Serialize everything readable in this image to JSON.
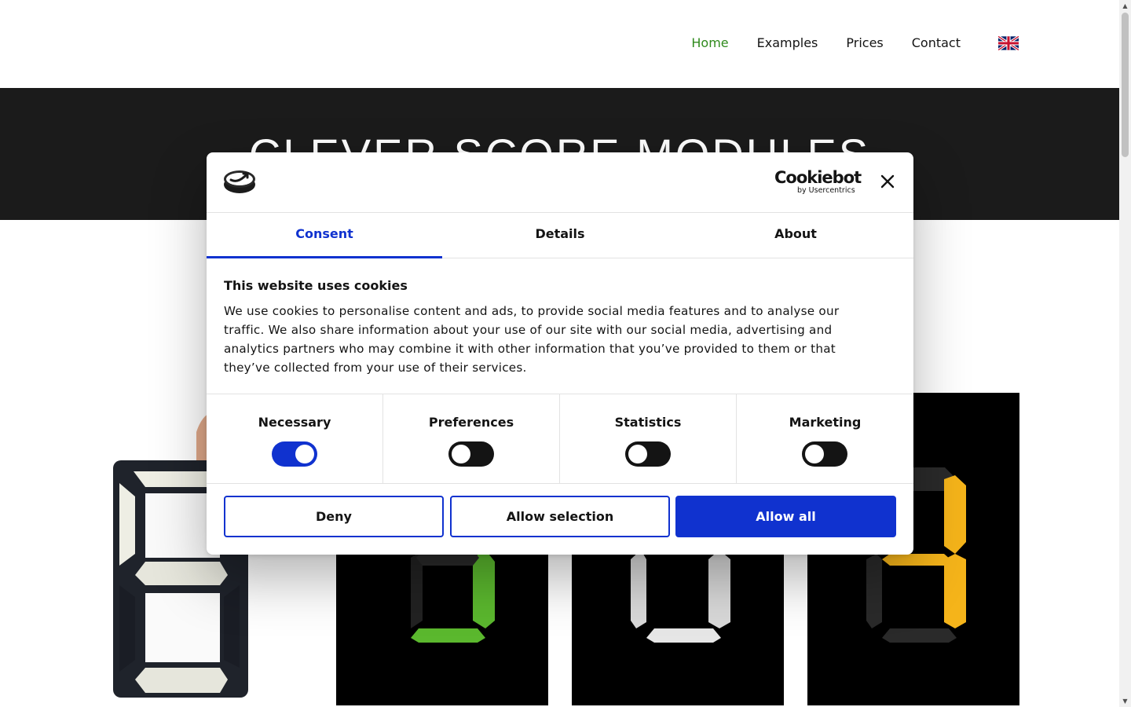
{
  "nav": {
    "items": [
      "Home",
      "Examples",
      "Prices",
      "Contact"
    ],
    "active": "Home",
    "language_flag": "uk-flag-icon"
  },
  "hero": {
    "title": "CLEVER SCORE MODULES"
  },
  "photos": {
    "digit_colors": [
      "#f0f0e8",
      "#5bb82e",
      "#d9d9d9",
      "#f5b41a"
    ]
  },
  "cookie_dialog": {
    "brand": "Cookiebot",
    "brand_sub": "by Usercentrics",
    "tabs": [
      "Consent",
      "Details",
      "About"
    ],
    "active_tab": "Consent",
    "heading": "This website uses cookies",
    "body": "We use cookies to personalise content and ads, to provide social media features and to analyse our traffic. We also share information about your use of our site with our social media, advertising and analytics partners who may combine it with other information that you’ve provided to them or that they’ve collected from your use of their services.",
    "toggles": [
      {
        "label": "Necessary",
        "on": true
      },
      {
        "label": "Preferences",
        "on": false
      },
      {
        "label": "Statistics",
        "on": false
      },
      {
        "label": "Marketing",
        "on": false
      }
    ],
    "buttons": {
      "deny": "Deny",
      "allow_selection": "Allow selection",
      "allow_all": "Allow all"
    },
    "accent_color": "#1032cf"
  }
}
